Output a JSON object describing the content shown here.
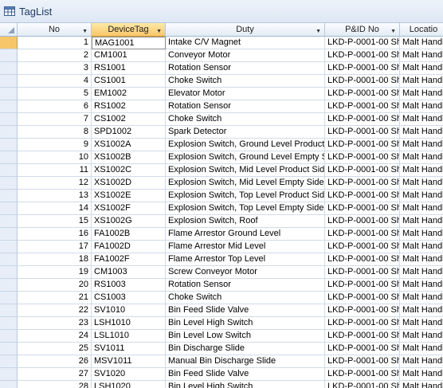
{
  "window": {
    "title": "TagList",
    "icon": "table-icon"
  },
  "columns": [
    {
      "label": "No",
      "has_dropdown": true
    },
    {
      "label": "DeviceTag",
      "has_dropdown": true,
      "sorted": true
    },
    {
      "label": "Duty",
      "has_dropdown": true
    },
    {
      "label": "P&ID No",
      "has_dropdown": true
    },
    {
      "label": "Locatio",
      "has_dropdown": false
    }
  ],
  "rows": [
    [
      "1",
      "MAG1001",
      "Intake C/V Magnet",
      "LKD-P-0001-00 Sh",
      "Malt Handl"
    ],
    [
      "2",
      "CM1001",
      "Conveyor Motor",
      "LKD-P-0001-00 Sh",
      "Malt Handl"
    ],
    [
      "3",
      "RS1001",
      "Rotation Sensor",
      "LKD-P-0001-00 Sh",
      "Malt Handl"
    ],
    [
      "4",
      "CS1001",
      "Choke Switch",
      "LKD-P-0001-00 Sh",
      "Malt Handl"
    ],
    [
      "5",
      "EM1002",
      "Elevator Motor",
      "LKD-P-0001-00 Sh",
      "Malt Handl"
    ],
    [
      "6",
      "RS1002",
      "Rotation Sensor",
      "LKD-P-0001-00 Sh",
      "Malt Handl"
    ],
    [
      "7",
      "CS1002",
      "Choke Switch",
      "LKD-P-0001-00 Sh",
      "Malt Handl"
    ],
    [
      "8",
      "SPD1002",
      "Spark Detector",
      "LKD-P-0001-00 Sh",
      "Malt Handl"
    ],
    [
      "9",
      "XS1002A",
      "Explosion Switch, Ground Level Product",
      "LKD-P-0001-00 Sh",
      "Malt Handl"
    ],
    [
      "10",
      "XS1002B",
      "Explosion Switch, Ground Level Empty S",
      "LKD-P-0001-00 Sh",
      "Malt Handl"
    ],
    [
      "11",
      "XS1002C",
      "Explosion Switch, Mid Level Product Side",
      "LKD-P-0001-00 Sh",
      "Malt Handl"
    ],
    [
      "12",
      "XS1002D",
      "Explosion Switch, Mid Level Empty Side",
      "LKD-P-0001-00 Sh",
      "Malt Handl"
    ],
    [
      "13",
      "XS1002E",
      "Explosion Switch, Top Level Product Sid",
      "LKD-P-0001-00 Sh",
      "Malt Handl"
    ],
    [
      "14",
      "XS1002F",
      "Explosion Switch, Top Level Empty Side",
      "LKD-P-0001-00 Sh",
      "Malt Handl"
    ],
    [
      "15",
      "XS1002G",
      "Explosion Switch, Roof",
      "LKD-P-0001-00 Sh",
      "Malt Handl"
    ],
    [
      "16",
      "FA1002B",
      "Flame Arrestor Ground Level",
      "LKD-P-0001-00 Sh",
      "Malt Handl"
    ],
    [
      "17",
      "FA1002D",
      "Flame Arrestor Mid Level",
      "LKD-P-0001-00 Sh",
      "Malt Handl"
    ],
    [
      "18",
      "FA1002F",
      "Flame Arrestor Top Level",
      "LKD-P-0001-00 Sh",
      "Malt Handl"
    ],
    [
      "19",
      "CM1003",
      "Screw Conveyor Motor",
      "LKD-P-0001-00 Sh",
      "Malt Handl"
    ],
    [
      "20",
      "RS1003",
      "Rotation Sensor",
      "LKD-P-0001-00 Sh",
      "Malt Handl"
    ],
    [
      "21",
      "CS1003",
      "Choke Switch",
      "LKD-P-0001-00 Sh",
      "Malt Handl"
    ],
    [
      "22",
      "SV1010",
      "Bin Feed Slide Valve",
      "LKD-P-0001-00 Sh",
      "Malt Handl"
    ],
    [
      "23",
      "LSH1010",
      "Bin Level High Switch",
      "LKD-P-0001-00 Sh",
      "Malt Handl"
    ],
    [
      "24",
      "LSL1010",
      "Bin Level Low Switch",
      "LKD-P-0001-00 Sh",
      "Malt Handl"
    ],
    [
      "25",
      "SV1011",
      "Bin Discharge Slide",
      "LKD-P-0001-00 Sh",
      "Malt Handl"
    ],
    [
      "26",
      "MSV1011",
      "Manual Bin Discharge Slide",
      "LKD-P-0001-00 Sh",
      "Malt Handl"
    ],
    [
      "27",
      "SV1020",
      "Bin Feed Slide Valve",
      "LKD-P-0001-00 Sh",
      "Malt Handl"
    ],
    [
      "28",
      "LSH1020",
      "Bin Level High Switch",
      "LKD-P-0001-00 Sh",
      "Malt Handl"
    ]
  ],
  "current_row": 0
}
